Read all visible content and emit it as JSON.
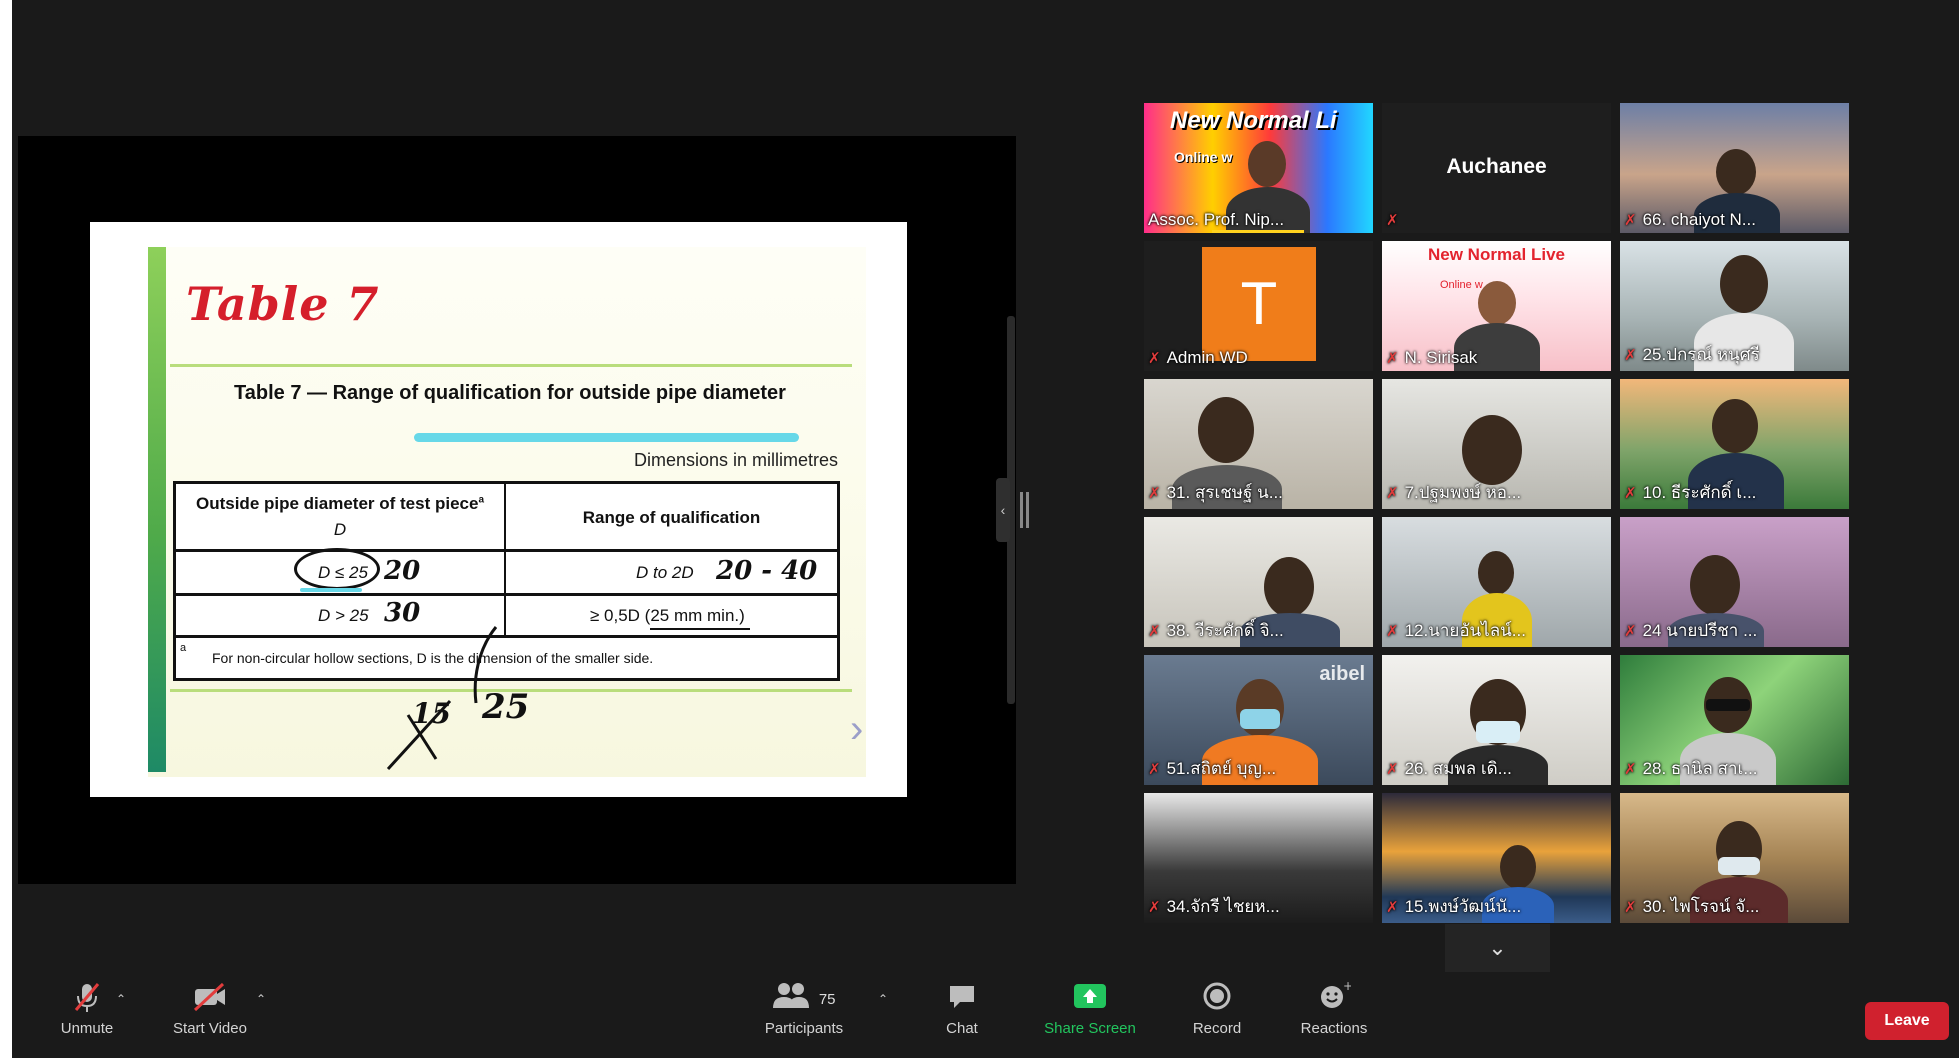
{
  "slide": {
    "title": "Table 7",
    "table_caption": "Table 7 — Range of qualification for outside pipe diameter",
    "dimensions_note": "Dimensions in millimetres",
    "header_col1": "Outside pipe diameter of test piece",
    "header_col1_superscript": "a",
    "header_col1_symbol": "D",
    "header_col2": "Range of qualification",
    "row1_col1": "D ≤ 25",
    "row1_col2": "D to 2D",
    "row2_col1": "D > 25",
    "row2_col2": "≥ 0,5D (25 mm min.)",
    "footnote_mark": "a",
    "footnote": "For non-circular hollow sections, D is the dimension of the smaller side.",
    "handwriting": {
      "row1_value": "20",
      "row1_range": "20 - 40",
      "row2_value": "30",
      "crossed": "15",
      "corrected": "25"
    },
    "next_arrow": "›"
  },
  "participants_tiles": [
    {
      "name": "Assoc. Prof. Nip...",
      "banner": "New Normal Li",
      "banner2": "Online w",
      "speaking": true
    },
    {
      "name": "Auchanee",
      "no_video": true
    },
    {
      "name": "66. chaiyot N..."
    },
    {
      "name": "Admin WD",
      "avatar_letter": "T",
      "avatar_color": "#f07d1a"
    },
    {
      "name": "N. Sirisak",
      "banner": "New Normal Live",
      "banner2": "Online w"
    },
    {
      "name": "25.ปกรณ์ หนุศรี"
    },
    {
      "name": "31. สุรเชษฐ์ น..."
    },
    {
      "name": "7.ปฐมพงษ์ หอ..."
    },
    {
      "name": "10. ธีระศักดิ์ เ..."
    },
    {
      "name": "38. วีระศักดิ์ จิ..."
    },
    {
      "name": "12.นายอันไลน์..."
    },
    {
      "name": "24 นายปรีชา ..."
    },
    {
      "name": "51.สถิตย์ บุญ...",
      "overlay": "aibel"
    },
    {
      "name": "26. สมพล เดิ..."
    },
    {
      "name": "28. ธานิล สาเ..."
    },
    {
      "name": "34.จักรี ไชยห..."
    },
    {
      "name": "15.พงษ์วัฒน์นั..."
    },
    {
      "name": "30. ไพโรจน์ จั..."
    }
  ],
  "toolbar": {
    "unmute": "Unmute",
    "start_video": "Start Video",
    "participants": "Participants",
    "participants_count": "75",
    "chat": "Chat",
    "share_screen": "Share Screen",
    "record": "Record",
    "reactions": "Reactions",
    "leave": "Leave"
  },
  "colors": {
    "leave": "#d0212e",
    "share_screen": "#22c55e",
    "muted_mic": "#e23c3c",
    "slide_title": "#d51f2b"
  },
  "icons": [
    "mic-muted-icon",
    "video-off-icon",
    "participants-icon",
    "chat-icon",
    "share-screen-icon",
    "record-icon",
    "reactions-icon",
    "chevron-down-icon",
    "chevron-up-icon"
  ]
}
